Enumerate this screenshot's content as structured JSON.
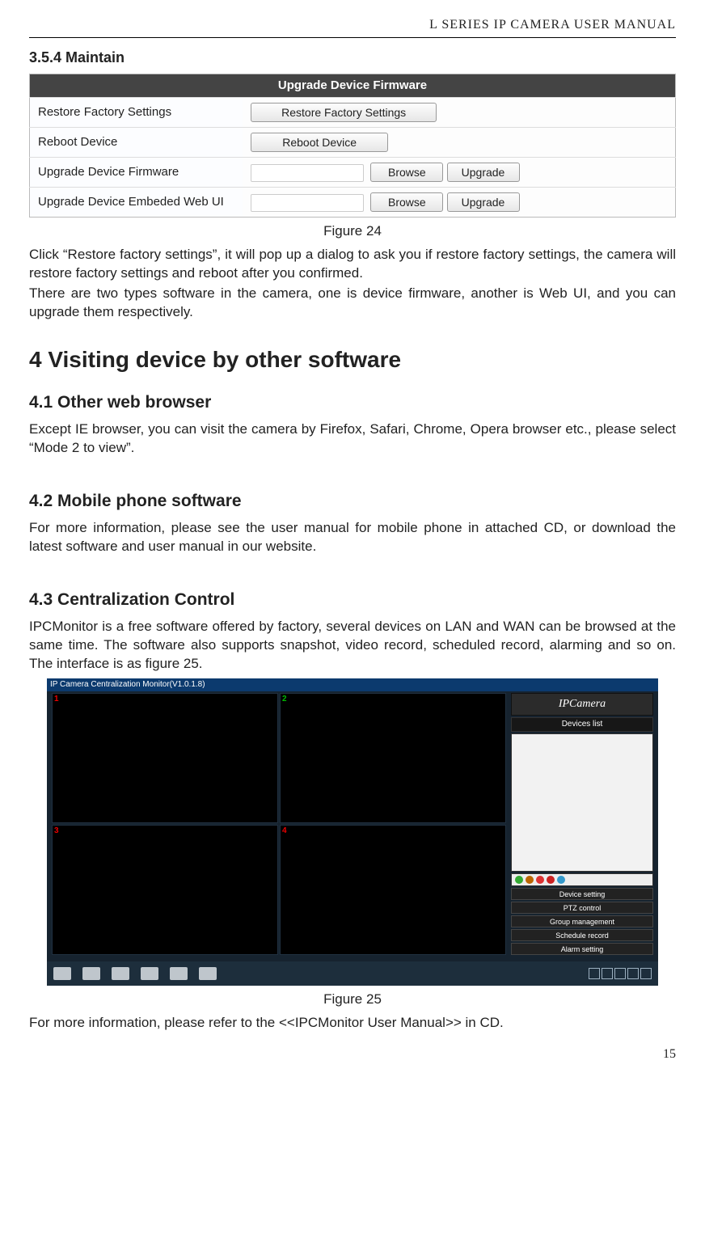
{
  "header": {
    "running_title": "L  SERIES  IP  CAMERA  USER  MANUAL"
  },
  "sec354": {
    "heading": "3.5.4   Maintain"
  },
  "fig24": {
    "title": "Upgrade Device Firmware",
    "rows": {
      "r1": {
        "label": "Restore Factory Settings",
        "button": "Restore Factory Settings"
      },
      "r2": {
        "label": "Reboot Device",
        "button": "Reboot Device"
      },
      "r3": {
        "label": "Upgrade Device Firmware",
        "browse": "Browse",
        "upgrade": "Upgrade"
      },
      "r4": {
        "label": "Upgrade Device Embeded Web UI",
        "browse": "Browse",
        "upgrade": "Upgrade"
      }
    },
    "caption": "Figure 24"
  },
  "p1": "Click  “Restore  factory  settings”,  it  will  pop  up  a  dialog  to  ask  you  if  restore  factory settings, the camera will restore factory settings and reboot after you confirmed.",
  "p2": "There are two types software in the camera, one is device firmware, another is Web UI, and you can upgrade them respectively.",
  "chap4": {
    "heading": "4   Visiting device by other software"
  },
  "sec41": {
    "heading": "4.1 Other web browser",
    "body": "Except IE browser, you can visit the camera by Firefox, Safari, Chrome, Opera browser etc., please select “Mode 2 to view”."
  },
  "sec42": {
    "heading": "4.2 Mobile phone software",
    "body": "For more information, please see the user manual for mobile phone in attached CD, or download the latest software and user manual in our website."
  },
  "sec43": {
    "heading": "4.3 Centralization Control",
    "body": "IPCMonitor is a free software offered by factory, several devices on LAN and WAN can be  browsed  at  the  same  time.  The  software  also  supports  snapshot,  video  record, scheduled record, alarming and so on. The interface is as figure 25."
  },
  "fig25": {
    "window_title": "IP Camera Centralization Monitor(V1.0.1.8)",
    "panes": [
      "1",
      "2",
      "3",
      "4"
    ],
    "side": {
      "logo": "IPCamera",
      "devices_header": "Devices list",
      "buttons": [
        "Device setting",
        "PTZ control",
        "Group management",
        "Schedule record",
        "Alarm setting"
      ]
    },
    "caption": "Figure 25"
  },
  "p3": "For more information, please refer to the <<IPCMonitor User Manual>> in CD.",
  "page_number": "15"
}
